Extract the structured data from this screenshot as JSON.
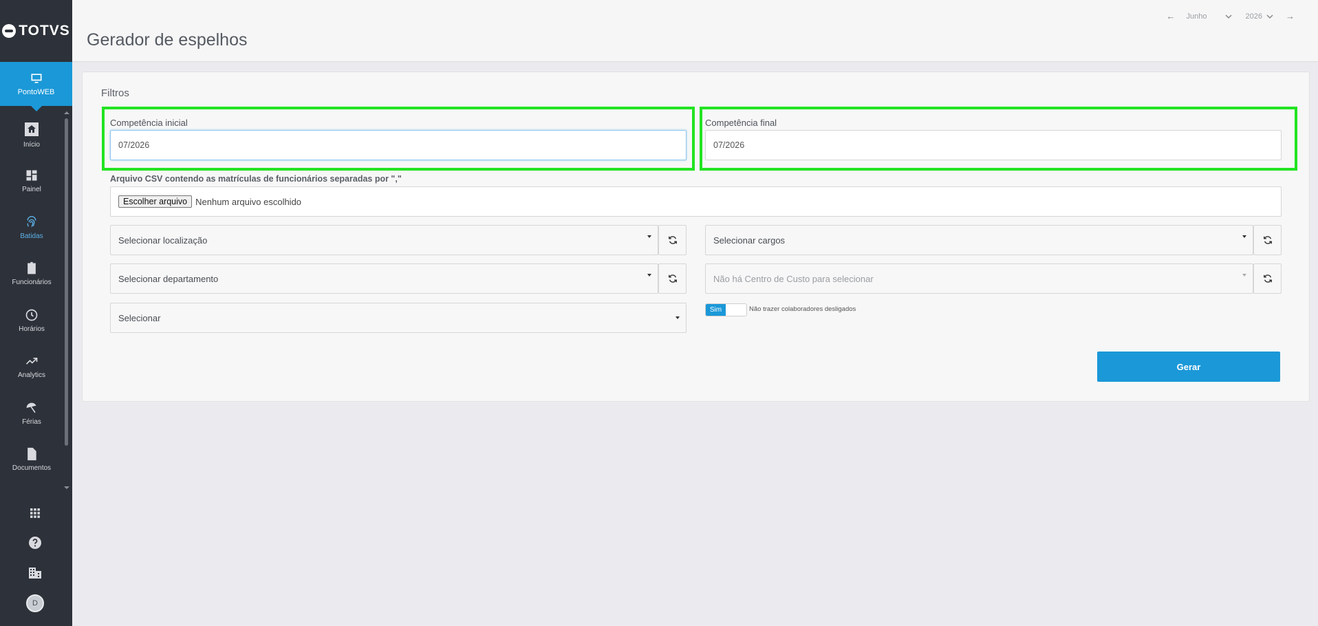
{
  "app": {
    "logo_text": "TOTVS"
  },
  "sidebar": {
    "active": {
      "label": "PontoWEB",
      "icon": "monitor-icon"
    },
    "items": [
      {
        "label": "Início",
        "icon": "home-icon"
      },
      {
        "label": "Painel",
        "icon": "dashboard-icon"
      },
      {
        "label": "Batidas",
        "icon": "fingerprint-icon"
      },
      {
        "label": "Funcionários",
        "icon": "badge-icon"
      },
      {
        "label": "Horários",
        "icon": "clock-icon"
      },
      {
        "label": "Analytics",
        "icon": "trending-up-icon"
      },
      {
        "label": "Férias",
        "icon": "beach-umbrella-icon"
      },
      {
        "label": "Documentos",
        "icon": "document-icon"
      }
    ],
    "bottom": [
      {
        "icon": "apps-grid-icon"
      },
      {
        "icon": "help-icon"
      },
      {
        "icon": "company-icon"
      }
    ],
    "avatar_initial": "D",
    "selected_color": "#5ab2e6"
  },
  "header": {
    "title": "Gerador de espelhos",
    "period": {
      "month": "Junho",
      "year": "2026"
    }
  },
  "form": {
    "section_title": "Filtros",
    "competencia_inicial": {
      "label": "Competência inicial",
      "value": "07/2026"
    },
    "competencia_final": {
      "label": "Competência final",
      "value": "07/2026"
    },
    "csv": {
      "label": "Arquivo CSV contendo as matrículas de funcionários separadas por \",\"",
      "button": "Escolher arquivo",
      "status": "Nenhum arquivo escolhido"
    },
    "localizacao": "Selecionar localização",
    "cargos": "Selecionar cargos",
    "departamento": "Selecionar departamento",
    "centro_custo": "Não há Centro de Custo para selecionar",
    "selecionar": "Selecionar",
    "toggle": {
      "on_label": "Sim",
      "label": "Não trazer colaboradores desligados"
    },
    "submit": "Gerar"
  },
  "colors": {
    "accent": "#1b98d8",
    "sidebar": "#2d3139",
    "highlight": "#22e322"
  }
}
